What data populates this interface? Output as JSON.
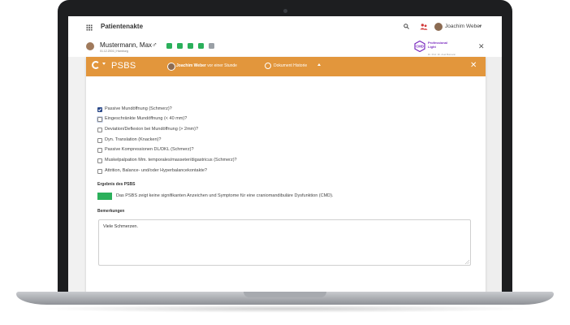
{
  "appbar": {
    "title": "Patientenakte",
    "user_name": "Joachim Weber"
  },
  "patient": {
    "name": "Mustermann",
    "first_name": ", Max",
    "sub": "01.12.2001 | Hamburg",
    "gender_symbol": "♂",
    "tool_colors": [
      "#2bb05b",
      "#2bb05b",
      "#2bb05b",
      "#2bb05b",
      "#9aa0a6"
    ],
    "cmd_logo_text": "CMD",
    "cmd_brand_line1": "Professional",
    "cmd_brand_line2": "Light",
    "cmd_sub": "Dr. Prof. Dr. Axel Bumann"
  },
  "modal": {
    "title": "PSBS",
    "author": "Joachim Weber",
    "author_time": " vor einer Stunde",
    "history_label": "Dokument Historie",
    "close_symbol": "✕",
    "accent_color": "#e2963c"
  },
  "checklist": [
    {
      "label": "Passive Mundöffnung (Schmerz)?",
      "checked": true
    },
    {
      "label": "Eingeschränkte Mundöffnung (< 40 mm)?",
      "checked": false
    },
    {
      "label": "Deviation/Deflexion bei Mundöffnung (> 2mm)?",
      "checked": false
    },
    {
      "label": "Dyn. Translation (Knacken)?",
      "checked": false
    },
    {
      "label": "Passive Kompressionen DL/DKL (Schmerz)?",
      "checked": false
    },
    {
      "label": "Muskelpalpation Mm. temporales/masseter/digastricus (Schmerz)?",
      "checked": false
    },
    {
      "label": "Attrition, Balance- und/oder Hyperbalancekontakte?",
      "checked": false
    }
  ],
  "result": {
    "label": "Ergebnis des PSBS",
    "color": "#2bb05b",
    "text": "Das PSBS zeigt keine signifikanten Anzeichen und Symptome für eine craniomandibuläre Dysfunktion (CMD)."
  },
  "remarks": {
    "label": "Bemerkungen",
    "value": "Viele Schmerzen."
  }
}
